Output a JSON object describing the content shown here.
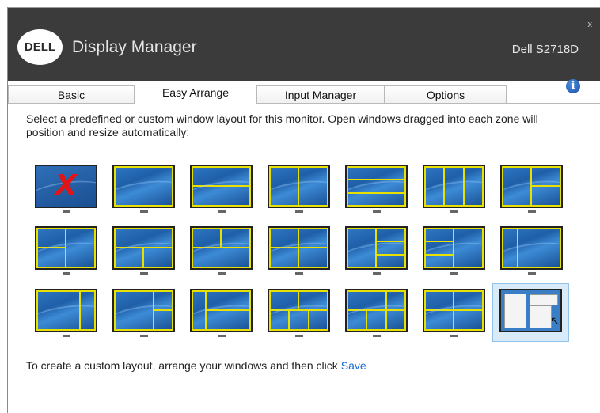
{
  "app": {
    "title": "Display Manager",
    "brand_logo": "DELL",
    "monitor": "Dell S2718D",
    "close_label": "x"
  },
  "tabs": [
    {
      "label": "Basic"
    },
    {
      "label": "Easy Arrange",
      "active": true
    },
    {
      "label": "Input Manager"
    },
    {
      "label": "Options"
    }
  ],
  "info_icon": "info-icon",
  "description": "Select a predefined or custom window layout for this monitor.  Open windows dragged into each zone will position and resize automatically:",
  "layouts": {
    "row1": [
      "none",
      "full",
      "top-bottom",
      "left-right",
      "three-rows",
      "three-cols",
      "left-plus-right-split"
    ],
    "row2": [
      "left-split-plus-right",
      "top-plus-bottom-split",
      "top-split-plus-bottom",
      "wide-left-plus-right-split",
      "left-plus-three-right",
      "three-left-plus-right",
      "left-narrow-plus-right"
    ],
    "row3": [
      "right-narrow",
      "left-wide-right-split",
      "three-cols-wide",
      "top-plus-bottom-three",
      "top-split-plus-bottom-three",
      "quad",
      "custom"
    ],
    "selected": "custom"
  },
  "footer": {
    "text": "To create a custom layout, arrange your windows and then click",
    "save_label": "Save"
  },
  "colors": {
    "titlebar": "#3b3b3b",
    "zone_lines": "#e8e000",
    "link": "#1a6ad1",
    "selected_bg": "#d9eaf8"
  }
}
